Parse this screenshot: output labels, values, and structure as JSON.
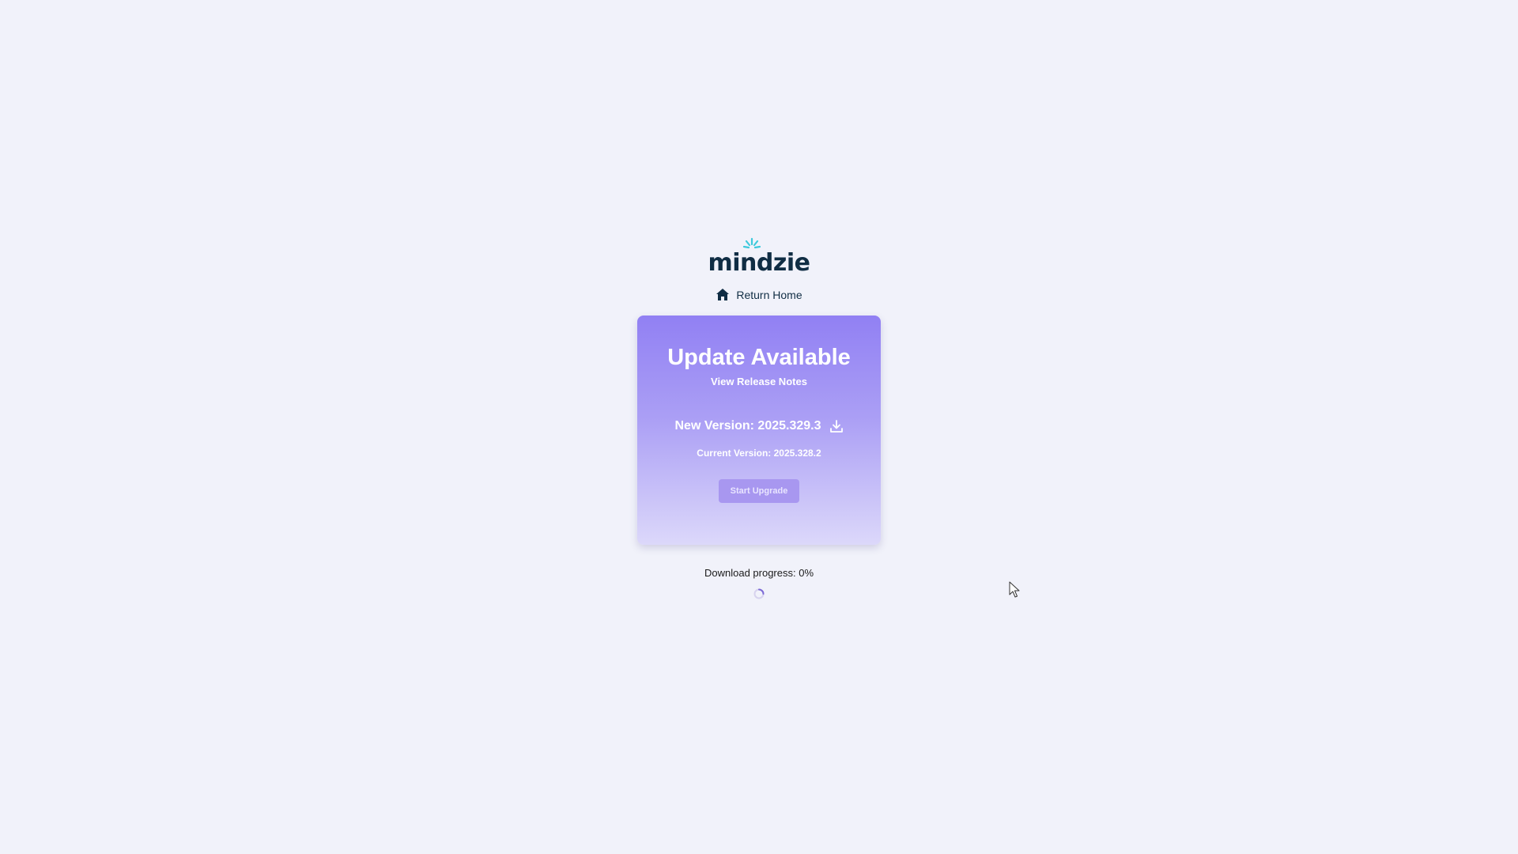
{
  "logo": {
    "text": "mindzie",
    "icon": "sparkle-icon",
    "color": "#102d44",
    "accent": "#3ec9dc"
  },
  "nav": {
    "return_home_label": "Return Home",
    "icon": "home-icon"
  },
  "update_card": {
    "title": "Update Available",
    "release_notes_link": "View Release Notes",
    "new_version_label": "New Version: 2025.329.3",
    "download_icon": "download-icon",
    "current_version_label": "Current Version: 2025.328.2",
    "upgrade_button_label": "Start Upgrade",
    "gradient_top": "#9180f3",
    "gradient_bottom": "#dcd8fa"
  },
  "progress": {
    "text": "Download progress: 0%",
    "value": 0,
    "icon": "loading-spinner-icon"
  }
}
